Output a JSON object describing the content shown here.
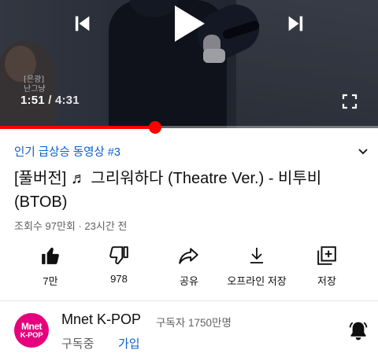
{
  "player": {
    "caption_line1": "[은광]",
    "caption_line2": "난그냥",
    "current_time": "1:51",
    "separator": " / ",
    "duration": "4:31",
    "progress": 0.41,
    "icons": {
      "prev": "skip-previous-icon",
      "play": "play-icon",
      "next": "skip-next-icon",
      "fullscreen": "fullscreen-icon"
    },
    "colors": {
      "progress": "#ff0000"
    }
  },
  "video": {
    "trending": "인기 급상승 동영상 #3",
    "title": "[풀버전] ♬ 그리워하다 (Theatre Ver.) - 비투비 (BTOB)",
    "meta": "조회수 97만회 · 23시간 전"
  },
  "actions": [
    {
      "label": "7만",
      "icon": "thumbs-up-icon"
    },
    {
      "label": "978",
      "icon": "thumbs-down-icon"
    },
    {
      "label": "공유",
      "icon": "share-icon"
    },
    {
      "label": "오프라인 저장",
      "icon": "download-icon"
    },
    {
      "label": "저장",
      "icon": "playlist-add-icon"
    }
  ],
  "channel": {
    "avatar_line1": "Mnet",
    "avatar_line2": "K-POP",
    "name": "Mnet K-POP",
    "subscribers": "구독자 1750만명",
    "status": "구독중",
    "join": "가입",
    "bell_icon": "bell-ringing-icon",
    "colors": {
      "avatar": "#e6007e",
      "link": "#065fd4"
    }
  }
}
